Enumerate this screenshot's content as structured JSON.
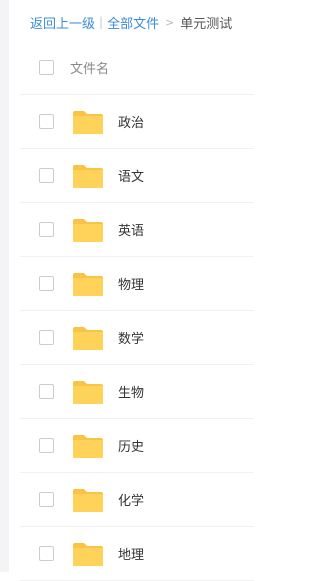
{
  "breadcrumb": {
    "back_label": "返回上一级",
    "separator": "|",
    "all_files_label": "全部文件",
    "arrow": ">",
    "current_label": "单元测试"
  },
  "list": {
    "header_label": "文件名",
    "items": [
      {
        "name": "政治",
        "icon": "folder-icon"
      },
      {
        "name": "语文",
        "icon": "folder-icon"
      },
      {
        "name": "英语",
        "icon": "folder-icon"
      },
      {
        "name": "物理",
        "icon": "folder-icon"
      },
      {
        "name": "数学",
        "icon": "folder-icon"
      },
      {
        "name": "生物",
        "icon": "folder-icon"
      },
      {
        "name": "历史",
        "icon": "folder-icon"
      },
      {
        "name": "化学",
        "icon": "folder-icon"
      },
      {
        "name": "地理",
        "icon": "folder-icon"
      }
    ]
  },
  "colors": {
    "link": "#3b8cd8",
    "folder": "#ffd35a",
    "folder_tab": "#f9c445"
  }
}
